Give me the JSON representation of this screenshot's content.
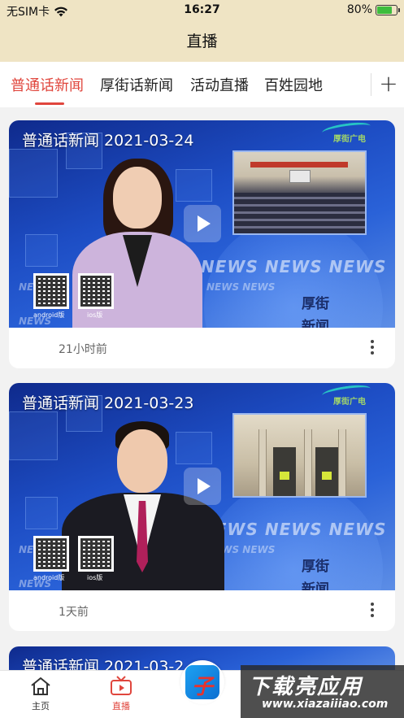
{
  "status_bar": {
    "carrier": "无SIM卡",
    "time": "16:27",
    "battery_percent": "80%",
    "battery_level": 0.8,
    "wifi_icon": "wifi-icon"
  },
  "header": {
    "title": "直播"
  },
  "tabs": [
    {
      "label": "普通话新闻",
      "active": true
    },
    {
      "label": "厚街话新闻",
      "active": false
    },
    {
      "label": "活动直播",
      "active": false
    },
    {
      "label": "百姓园地",
      "active": false
    }
  ],
  "add_tab_icon": "plus-icon",
  "videos": [
    {
      "title": "普通话新闻 2021-03-24",
      "time_ago": "21小时前",
      "station_logo": "厚街广电",
      "overlay_logo": "厚街\n新闻",
      "qr_labels": [
        "android版",
        "ios版"
      ],
      "news_banner": "NEWS NEWS NEWS"
    },
    {
      "title": "普通话新闻 2021-03-23",
      "time_ago": "1天前",
      "station_logo": "厚街广电",
      "overlay_logo": "厚街\n新闻",
      "qr_labels": [
        "android版",
        "ios版"
      ],
      "news_banner": "NEWS NEWS NEWS"
    },
    {
      "title": "普通话新闻 2021-03-2"
    }
  ],
  "tab_bar": {
    "items": [
      {
        "label": "主页",
        "icon": "home-icon",
        "active": false
      },
      {
        "label": "直播",
        "icon": "tv-icon",
        "active": true
      }
    ],
    "center_icon": "app-logo-icon"
  },
  "watermark": {
    "cn": "下载亮应用",
    "en": "www.xiazaiiiao.com"
  },
  "colors": {
    "accent": "#e0463d",
    "header_bg": "#efe4c4"
  }
}
